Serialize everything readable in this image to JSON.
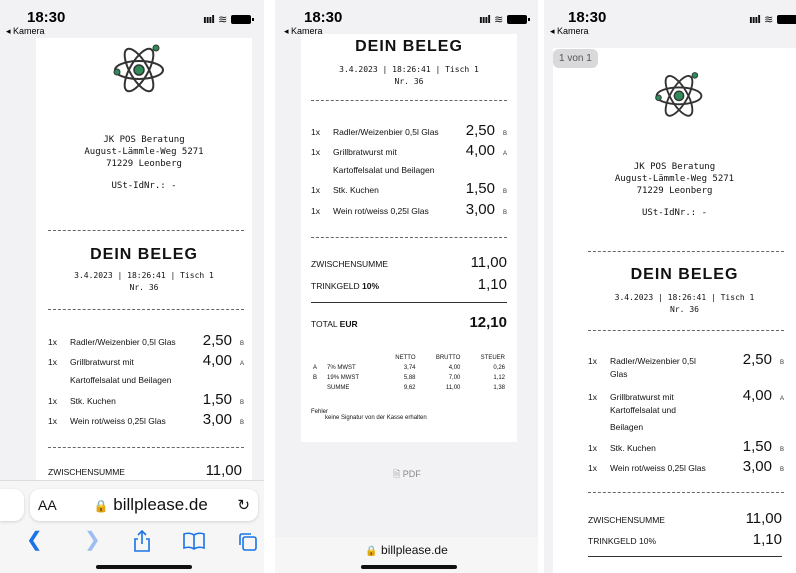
{
  "status": {
    "time": "18:30",
    "back": "◂ Kamera"
  },
  "shop": {
    "name": "JK POS Beratung",
    "street": "August-Lämmle-Weg 5271",
    "city": "71229 Leonberg",
    "vat": "USt-IdNr.: -"
  },
  "receipt": {
    "title": "DEIN BELEG",
    "datetime": "3.4.2023 | 18:26:41 | Tisch 1",
    "number": "Nr. 36",
    "items": [
      {
        "qty": "1x",
        "desc": "Radler/Weizenbier 0,5l Glas",
        "price": "2,50",
        "tax": "B"
      },
      {
        "qty": "1x",
        "desc": "Grillbratwurst mit",
        "desc2": "Kartoffelsalat und Beilagen",
        "price": "4,00",
        "tax": "A"
      },
      {
        "qty": "1x",
        "desc": "Stk. Kuchen",
        "price": "1,50",
        "tax": "B"
      },
      {
        "qty": "1x",
        "desc": "Wein rot/weiss 0,25l Glas",
        "price": "3,00",
        "tax": "B"
      }
    ],
    "item1_p3_a": "Radler/Weizenbier 0,5l",
    "item1_p3_b": "Glas",
    "item2_p3_a": "Grillbratwurst mit",
    "item2_p3_b": "Kartoffelsalat und",
    "item2_p3_c": "Beilagen",
    "subtotal_label": "ZWISCHENSUMME",
    "subtotal": "11,00",
    "tip_label": "TRINKGELD",
    "tip_pct": "10%",
    "tip_label_full": "TRINKGELD 10%",
    "tip": "1,10",
    "total_label": "TOTAL",
    "total_currency": "EUR",
    "total": "12,10",
    "tax_table": {
      "headers": [
        "NETTO",
        "BRUTTO",
        "STEUER"
      ],
      "rows": [
        {
          "code": "A",
          "label": "7% MWST",
          "netto": "3,74",
          "brutto": "4,00",
          "steuer": "0,26"
        },
        {
          "code": "B",
          "label": "19% MWST",
          "netto": "5,88",
          "brutto": "7,00",
          "steuer": "1,12"
        },
        {
          "code": "",
          "label": "SUMME",
          "netto": "9,62",
          "brutto": "11,00",
          "steuer": "1,38"
        }
      ]
    },
    "error_label": "Fehler",
    "error_text": "keine Signatur von der Kasse erhalten"
  },
  "browser": {
    "aa": "AA",
    "host": "billplease.de",
    "pdf_label": "PDF",
    "page_badge": "1 von 1"
  },
  "icons": {
    "logo": "atom-icon",
    "lock": "lock-icon",
    "reload": "reload-icon",
    "back": "chevron-left-icon",
    "forward": "chevron-right-icon",
    "share": "share-icon",
    "bookmarks": "book-icon",
    "tabs": "tabs-icon",
    "pdf": "document-icon"
  },
  "colors": {
    "accent": "#1a73e8",
    "logo_green": "#2e8b57"
  }
}
